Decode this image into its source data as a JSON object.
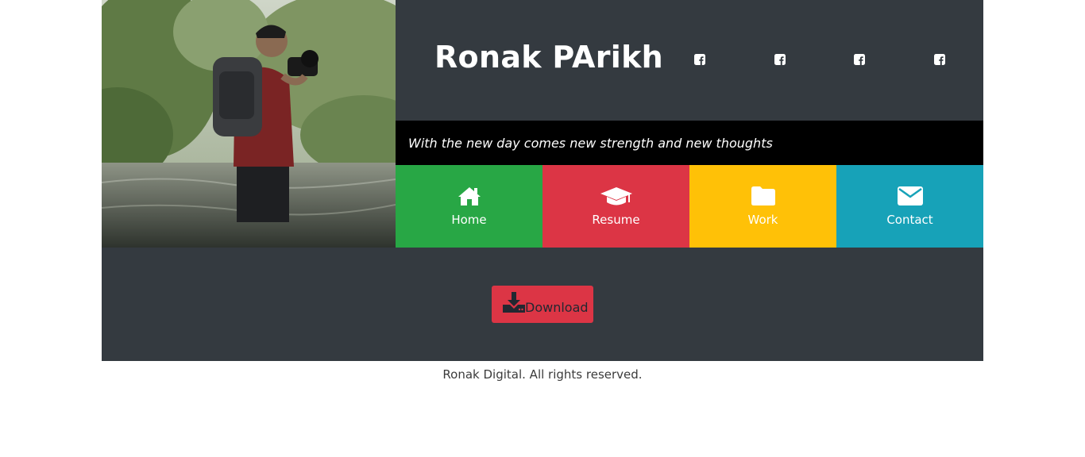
{
  "header": {
    "name": "Ronak PArikh",
    "social": [
      {
        "icon": "facebook-square-icon"
      },
      {
        "icon": "facebook-square-icon"
      },
      {
        "icon": "facebook-square-icon"
      },
      {
        "icon": "facebook-square-icon"
      }
    ]
  },
  "tagline": "With the new day comes new strength and new thoughts",
  "nav": [
    {
      "label": "Home",
      "icon": "home-icon",
      "color": "#28a745"
    },
    {
      "label": "Resume",
      "icon": "graduation-cap-icon",
      "color": "#dc3545"
    },
    {
      "label": "Work",
      "icon": "folder-icon",
      "color": "#ffc107"
    },
    {
      "label": "Contact",
      "icon": "envelope-icon",
      "color": "#17a2b8"
    }
  ],
  "download": {
    "label": "Download",
    "icon": "download-icon"
  },
  "footer": "Ronak Digital. All rights reserved.",
  "colors": {
    "dark": "#343a40",
    "black": "#000000",
    "danger": "#dc3545"
  }
}
